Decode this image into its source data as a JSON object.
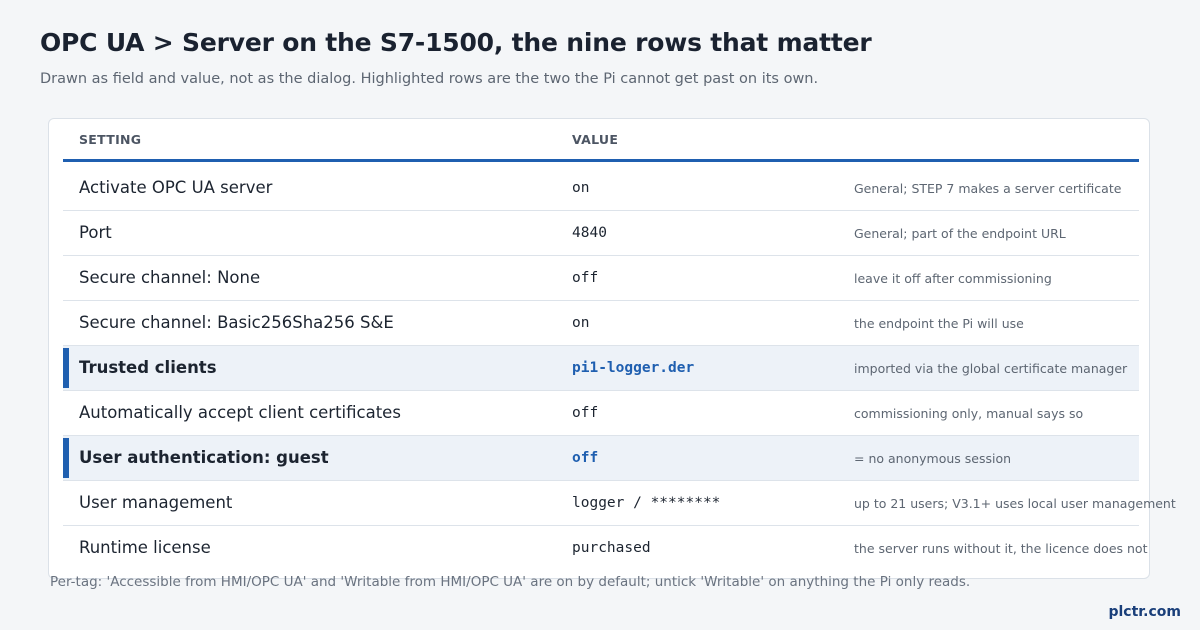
{
  "header": {
    "title": "OPC UA > Server on the S7-1500, the nine rows that matter",
    "subtitle": "Drawn as field and value, not as the dialog. Highlighted rows are the two the Pi cannot get past on its own."
  },
  "table": {
    "columns": [
      "SETTING",
      "VALUE"
    ],
    "rows": [
      {
        "setting": "Activate OPC UA server",
        "value": "on",
        "note": "General; STEP 7 makes a server certificate",
        "highlighted": false
      },
      {
        "setting": "Port",
        "value": "4840",
        "note": "General; part of the endpoint URL",
        "highlighted": false
      },
      {
        "setting": "Secure channel: None",
        "value": "off",
        "note": "leave it off after commissioning",
        "highlighted": false
      },
      {
        "setting": "Secure channel: Basic256Sha256 S&E",
        "value": "on",
        "note": "the endpoint the Pi will use",
        "highlighted": false
      },
      {
        "setting": "Trusted clients",
        "value": "pi1-logger.der",
        "note": "imported via the global certificate manager",
        "highlighted": true
      },
      {
        "setting": "Automatically accept client certificates",
        "value": "off",
        "note": "commissioning only, manual says so",
        "highlighted": false
      },
      {
        "setting": "User authentication: guest",
        "value": "off",
        "note": "= no anonymous session",
        "highlighted": true
      },
      {
        "setting": "User management",
        "value": "logger / ********",
        "note": "up to 21 users; V3.1+ uses local user management",
        "highlighted": false
      },
      {
        "setting": "Runtime license",
        "value": "purchased",
        "note": "the server runs without it, the licence does not",
        "highlighted": false
      }
    ]
  },
  "footnote": "Per-tag: 'Accessible from HMI/OPC UA' and 'Writable from HMI/OPC UA' are on by default; untick 'Writable' on anything the Pi only reads.",
  "brand": "plctr.com",
  "colors": {
    "accent": "#1f5fb0",
    "highlight_bg": "#edf2f8",
    "background": "#f4f6f8"
  }
}
